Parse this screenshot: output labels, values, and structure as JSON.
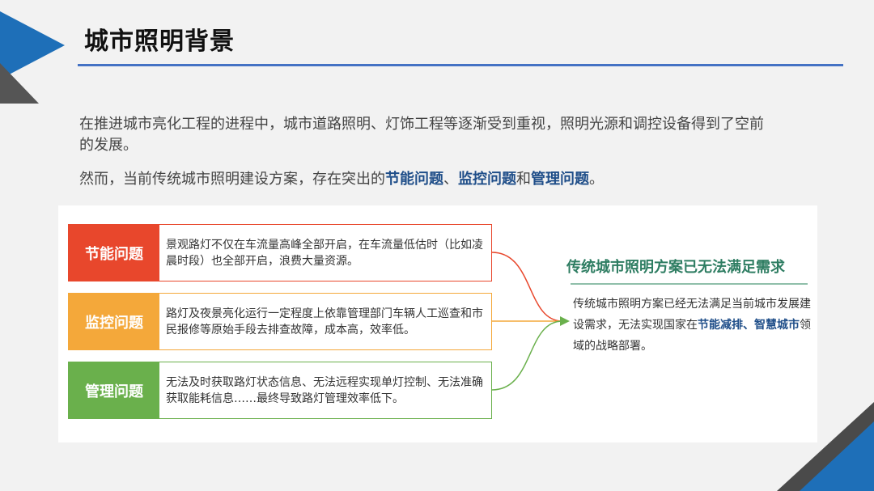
{
  "title": "城市照明背景",
  "intro": {
    "p1": "在推进城市亮化工程的进程中，城市道路照明、灯饰工程等逐渐受到重视，照明光源和调控设备得到了空前的发展。",
    "p2_prefix": "然而，当前传统城市照明建设方案，存在突出的",
    "p2_hl1": "节能问题",
    "p2_sep1": "、",
    "p2_hl2": "监控问题",
    "p2_sep2": "和",
    "p2_hl3": "管理问题",
    "p2_suffix": "。"
  },
  "problems": [
    {
      "label": "节能问题",
      "text": "景观路灯不仅在车流量高峰全部开启，在车流量低估时（比如凌晨时段）也全部开启，浪费大量资源。",
      "color": "#e8472c"
    },
    {
      "label": "监控问题",
      "text": "路灯及夜景亮化运行一定程度上依靠管理部门车辆人工巡查和市民报修等原始手段去排查故障，成本高，效率低。",
      "color": "#f4a83a"
    },
    {
      "label": "管理问题",
      "text": "无法及时获取路灯状态信息、无法远程实现单灯控制、无法准确获取能耗信息……最终导致路灯管理效率低下。",
      "color": "#6ab04c"
    }
  ],
  "conclusion": {
    "title": "传统城市照明方案已无法满足需求",
    "body_prefix": "传统城市照明方案已经无法满足当前城市发展建设需求，无法实现国家在",
    "body_hl": "节能减排、智慧城市",
    "body_suffix": "领域的战略部署。"
  },
  "colors": {
    "accent": "#1e6fb8",
    "highlight": "#1f4e89",
    "conclusion_title": "#2e7d62"
  }
}
